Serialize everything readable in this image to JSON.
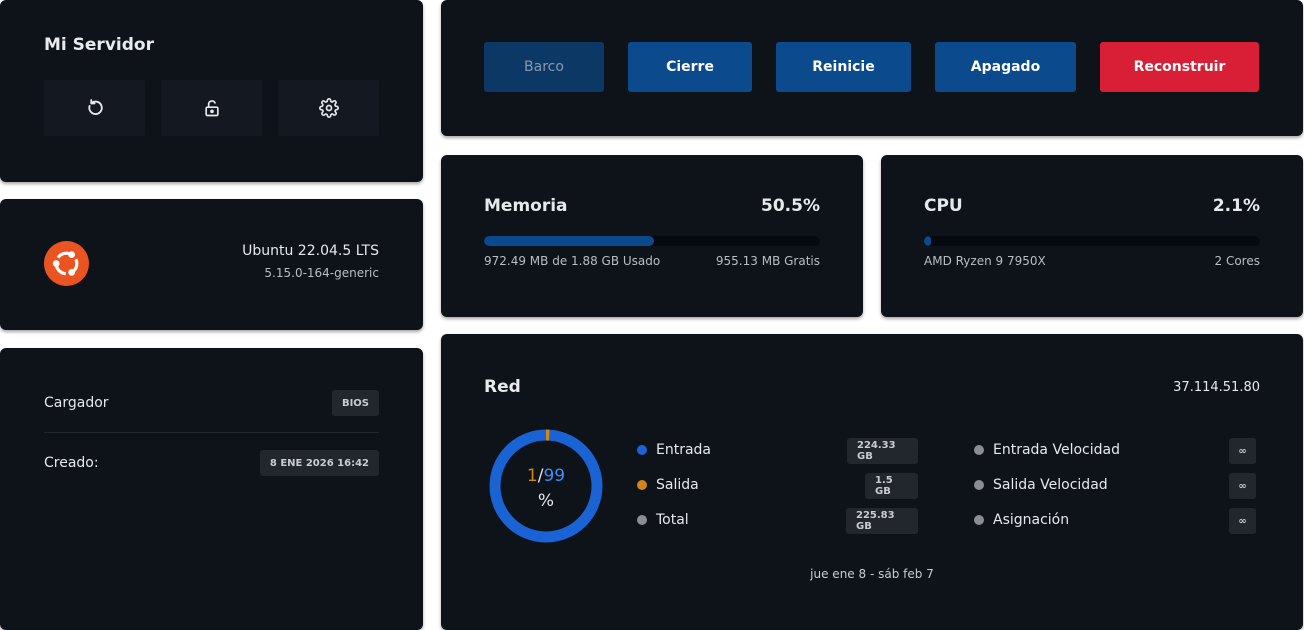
{
  "server": {
    "title": "Mi Servidor",
    "icons": [
      "restart-icon",
      "unlock-icon",
      "gear-icon"
    ]
  },
  "actions": [
    {
      "label": "Barco",
      "state": "disabled"
    },
    {
      "label": "Cierre",
      "state": "normal"
    },
    {
      "label": "Reinicie",
      "state": "normal"
    },
    {
      "label": "Apagado",
      "state": "normal"
    },
    {
      "label": "Reconstruir",
      "state": "danger"
    }
  ],
  "os": {
    "name": "Ubuntu 22.04.5 LTS",
    "kernel": "5.15.0-164-generic",
    "logo_icon": "ubuntu-logo-icon",
    "logo_color": "#e95420"
  },
  "memory": {
    "title": "Memoria",
    "percent_label": "50.5%",
    "percent": 50.5,
    "used_label": "972.49 MB de 1.88 GB Usado",
    "free_label": "955.13 MB Gratis"
  },
  "cpu": {
    "title": "CPU",
    "percent_label": "2.1%",
    "percent": 2.1,
    "model": "AMD Ryzen 9 7950X",
    "cores": "2 Cores"
  },
  "boot": {
    "loader_label": "Cargador",
    "loader_value": "BIOS",
    "created_label": "Creado:",
    "created_value": "8 ENE 2026 16:42"
  },
  "network": {
    "title": "Red",
    "ip": "37.114.51.80",
    "donut": {
      "used": "1",
      "sep": "/",
      "total": "99",
      "unit": "%"
    },
    "legend": [
      {
        "label": "Entrada",
        "value": "224.33 GB",
        "color": "#1a63d4"
      },
      {
        "label": "Salida",
        "value": "1.5 GB",
        "color": "#d4851a"
      },
      {
        "label": "Total",
        "value": "225.83 GB",
        "color": "#8a8d93"
      }
    ],
    "speed": [
      {
        "label": "Entrada Velocidad",
        "value": "∞",
        "color": "#8a8d93"
      },
      {
        "label": "Salida Velocidad",
        "value": "∞",
        "color": "#8a8d93"
      },
      {
        "label": "Asignación",
        "value": "∞",
        "color": "#8a8d93"
      }
    ],
    "date_range": "jue ene 8 - sáb feb 7"
  },
  "colors": {
    "primary": "#0c4a8e",
    "danger": "#d81f35",
    "card_bg": "#0e1219",
    "donut_ring": "#1a63d4",
    "donut_used": "#d4851a"
  }
}
